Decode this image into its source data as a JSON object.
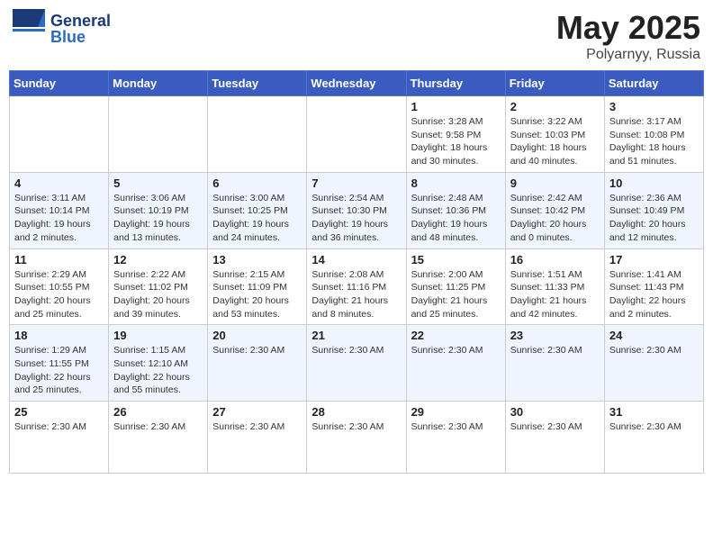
{
  "header": {
    "logo_line1": "General",
    "logo_line2": "Blue",
    "title": "May 2025",
    "location": "Polyarnyy, Russia"
  },
  "calendar": {
    "days_of_week": [
      "Sunday",
      "Monday",
      "Tuesday",
      "Wednesday",
      "Thursday",
      "Friday",
      "Saturday"
    ],
    "weeks": [
      [
        {
          "day": "",
          "info": ""
        },
        {
          "day": "",
          "info": ""
        },
        {
          "day": "",
          "info": ""
        },
        {
          "day": "",
          "info": ""
        },
        {
          "day": "1",
          "info": "Sunrise: 3:28 AM\nSunset: 9:58 PM\nDaylight: 18 hours\nand 30 minutes."
        },
        {
          "day": "2",
          "info": "Sunrise: 3:22 AM\nSunset: 10:03 PM\nDaylight: 18 hours\nand 40 minutes."
        },
        {
          "day": "3",
          "info": "Sunrise: 3:17 AM\nSunset: 10:08 PM\nDaylight: 18 hours\nand 51 minutes."
        }
      ],
      [
        {
          "day": "4",
          "info": "Sunrise: 3:11 AM\nSunset: 10:14 PM\nDaylight: 19 hours\nand 2 minutes."
        },
        {
          "day": "5",
          "info": "Sunrise: 3:06 AM\nSunset: 10:19 PM\nDaylight: 19 hours\nand 13 minutes."
        },
        {
          "day": "6",
          "info": "Sunrise: 3:00 AM\nSunset: 10:25 PM\nDaylight: 19 hours\nand 24 minutes."
        },
        {
          "day": "7",
          "info": "Sunrise: 2:54 AM\nSunset: 10:30 PM\nDaylight: 19 hours\nand 36 minutes."
        },
        {
          "day": "8",
          "info": "Sunrise: 2:48 AM\nSunset: 10:36 PM\nDaylight: 19 hours\nand 48 minutes."
        },
        {
          "day": "9",
          "info": "Sunrise: 2:42 AM\nSunset: 10:42 PM\nDaylight: 20 hours\nand 0 minutes."
        },
        {
          "day": "10",
          "info": "Sunrise: 2:36 AM\nSunset: 10:49 PM\nDaylight: 20 hours\nand 12 minutes."
        }
      ],
      [
        {
          "day": "11",
          "info": "Sunrise: 2:29 AM\nSunset: 10:55 PM\nDaylight: 20 hours\nand 25 minutes."
        },
        {
          "day": "12",
          "info": "Sunrise: 2:22 AM\nSunset: 11:02 PM\nDaylight: 20 hours\nand 39 minutes."
        },
        {
          "day": "13",
          "info": "Sunrise: 2:15 AM\nSunset: 11:09 PM\nDaylight: 20 hours\nand 53 minutes."
        },
        {
          "day": "14",
          "info": "Sunrise: 2:08 AM\nSunset: 11:16 PM\nDaylight: 21 hours\nand 8 minutes."
        },
        {
          "day": "15",
          "info": "Sunrise: 2:00 AM\nSunset: 11:25 PM\nDaylight: 21 hours\nand 25 minutes."
        },
        {
          "day": "16",
          "info": "Sunrise: 1:51 AM\nSunset: 11:33 PM\nDaylight: 21 hours\nand 42 minutes."
        },
        {
          "day": "17",
          "info": "Sunrise: 1:41 AM\nSunset: 11:43 PM\nDaylight: 22 hours\nand 2 minutes."
        }
      ],
      [
        {
          "day": "18",
          "info": "Sunrise: 1:29 AM\nSunset: 11:55 PM\nDaylight: 22 hours\nand 25 minutes."
        },
        {
          "day": "19",
          "info": "Sunrise: 1:15 AM\nSunset: 12:10 AM\nDaylight: 22 hours\nand 55 minutes."
        },
        {
          "day": "20",
          "info": "Sunrise: 2:30 AM"
        },
        {
          "day": "21",
          "info": "Sunrise: 2:30 AM"
        },
        {
          "day": "22",
          "info": "Sunrise: 2:30 AM"
        },
        {
          "day": "23",
          "info": "Sunrise: 2:30 AM"
        },
        {
          "day": "24",
          "info": "Sunrise: 2:30 AM"
        }
      ],
      [
        {
          "day": "25",
          "info": "Sunrise: 2:30 AM"
        },
        {
          "day": "26",
          "info": "Sunrise: 2:30 AM"
        },
        {
          "day": "27",
          "info": "Sunrise: 2:30 AM"
        },
        {
          "day": "28",
          "info": "Sunrise: 2:30 AM"
        },
        {
          "day": "29",
          "info": "Sunrise: 2:30 AM"
        },
        {
          "day": "30",
          "info": "Sunrise: 2:30 AM"
        },
        {
          "day": "31",
          "info": "Sunrise: 2:30 AM"
        }
      ]
    ]
  }
}
